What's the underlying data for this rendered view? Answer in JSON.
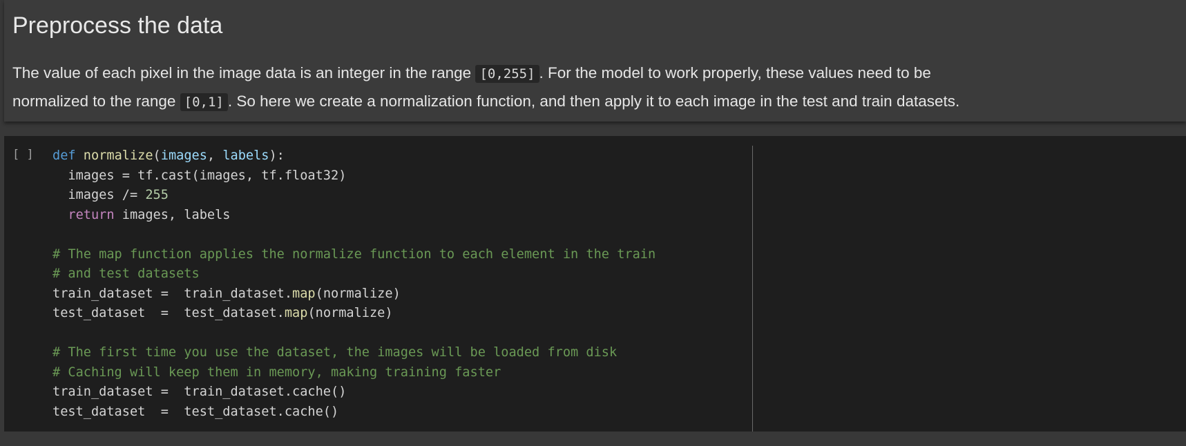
{
  "markdown_cell": {
    "heading": "Preprocess the data",
    "para": {
      "t1": "The value of each pixel in the image data is an integer in the range ",
      "code1": "[0,255]",
      "t2": ". For the model to work properly, these values need to be",
      "t3": "normalized to the range ",
      "code2": "[0,1]",
      "t4": ". So here we create a normalization function, and then apply it to each image in the test and train datasets."
    }
  },
  "code_cell": {
    "exec_indicator": "[ ]",
    "tokens": {
      "l1": {
        "kw": "def",
        "sp1": " ",
        "fn": "normalize",
        "p1": "(",
        "a1": "images",
        "c1": ", ",
        "a2": "labels",
        "p2": "):"
      },
      "l2": {
        "text": "  images = tf.cast(images, tf.float32)"
      },
      "l3": {
        "pre": "  images /= ",
        "num": "255"
      },
      "l4": {
        "pre": "  ",
        "kw": "return",
        "post": " images, labels"
      },
      "l6": {
        "cm": "# The map function applies the normalize function to each element in the train"
      },
      "l7": {
        "cm": "# and test datasets"
      },
      "l8": {
        "pre": "train_dataset =  train_dataset.",
        "fn": "map",
        "post": "(normalize)"
      },
      "l9": {
        "pre": "test_dataset  =  test_dataset.",
        "fn": "map",
        "post": "(normalize)"
      },
      "l11": {
        "cm": "# The first time you use the dataset, the images will be loaded from disk"
      },
      "l12": {
        "cm": "# Caching will keep them in memory, making training faster"
      },
      "l13": {
        "text": "train_dataset =  train_dataset.cache()"
      },
      "l14": {
        "text": "test_dataset  =  test_dataset.cache()"
      }
    }
  }
}
